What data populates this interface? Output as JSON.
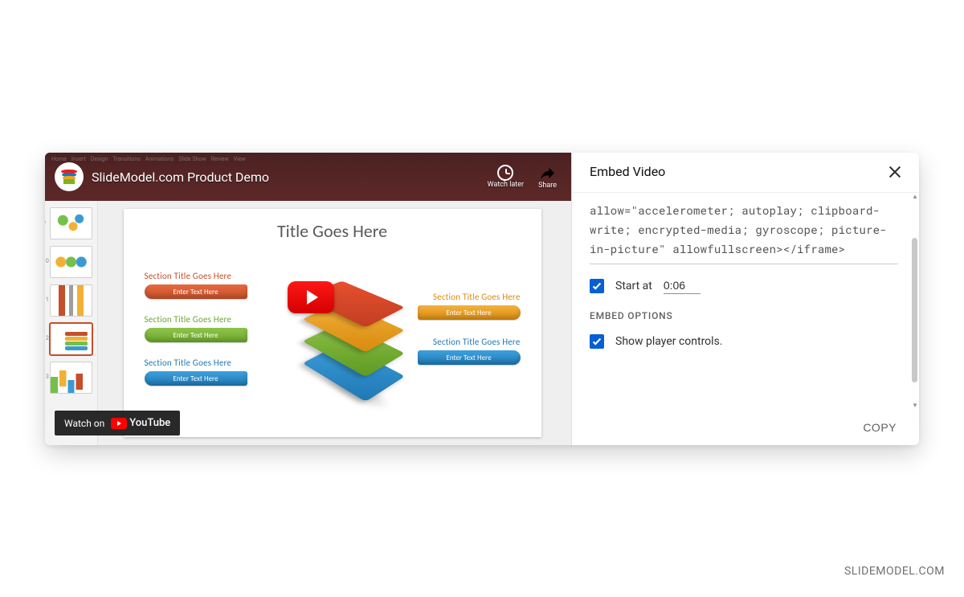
{
  "video": {
    "title": "SlideModel.com Product Demo",
    "watch_later": "Watch later",
    "share": "Share",
    "watch_on_prefix": "Watch on",
    "watch_on_brand": "YouTube",
    "ribbon_tabs": [
      "Home",
      "Insert",
      "Design",
      "Transitions",
      "Animations",
      "Slide Show",
      "Review",
      "View"
    ]
  },
  "slide": {
    "title": "Title Goes Here",
    "section_label": "Section Title Goes Here",
    "pill_text": "Enter Text Here"
  },
  "embed": {
    "panel_title": "Embed Video",
    "code": "allow=\"accelerometer; autoplay; clipboard-write; encrypted-media; gyroscope; picture-in-picture\" allowfullscreen></iframe>",
    "start_at_label": "Start at",
    "start_at_value": "0:06",
    "start_at_checked": true,
    "options_heading": "EMBED OPTIONS",
    "show_controls_label": "Show player controls.",
    "show_controls_checked": true,
    "copy_label": "COPY"
  },
  "watermark": "SLIDEMODEL.COM"
}
